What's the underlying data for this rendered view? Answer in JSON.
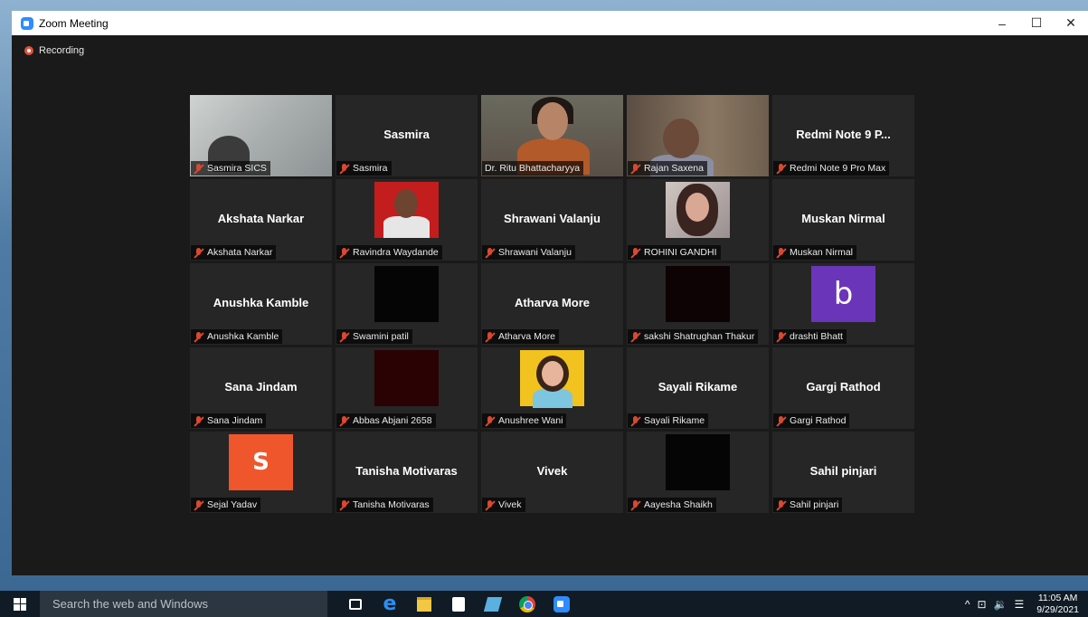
{
  "window": {
    "title": "Zoom Meeting",
    "controls": {
      "minimize": "–",
      "maximize": "☐",
      "close": "✕"
    }
  },
  "recording": {
    "label": "Recording"
  },
  "participants": [
    {
      "tile_name": "",
      "label": "Sasmira SICS"
    },
    {
      "tile_name": "Sasmira",
      "label": "Sasmira"
    },
    {
      "tile_name": "",
      "label": "Dr. Ritu Bhattacharyya"
    },
    {
      "tile_name": "",
      "label": "Rajan Saxena"
    },
    {
      "tile_name": "Redmi Note 9 P...",
      "label": "Redmi Note 9 Pro Max"
    },
    {
      "tile_name": "Akshata Narkar",
      "label": "Akshata Narkar"
    },
    {
      "tile_name": "",
      "label": "Ravindra Waydande"
    },
    {
      "tile_name": "Shrawani Valanju",
      "label": "Shrawani Valanju"
    },
    {
      "tile_name": "",
      "label": "ROHINI GANDHI"
    },
    {
      "tile_name": "Muskan Nirmal",
      "label": "Muskan Nirmal"
    },
    {
      "tile_name": "Anushka Kamble",
      "label": "Anushka Kamble"
    },
    {
      "tile_name": "",
      "label": "Swamini patil"
    },
    {
      "tile_name": "Atharva More",
      "label": "Atharva More"
    },
    {
      "tile_name": "",
      "label": "sakshi Shatrughan Thakur"
    },
    {
      "tile_name": "",
      "label": "drashti Bhatt",
      "avatar_letter": "b"
    },
    {
      "tile_name": "Sana Jindam",
      "label": "Sana Jindam"
    },
    {
      "tile_name": "",
      "label": "Abbas Abjani 2658"
    },
    {
      "tile_name": "",
      "label": "Anushree Wani"
    },
    {
      "tile_name": "Sayali Rikame",
      "label": "Sayali Rikame"
    },
    {
      "tile_name": "Gargi Rathod",
      "label": "Gargi Rathod"
    },
    {
      "tile_name": "",
      "label": "Sejal Yadav",
      "avatar_letter": "S"
    },
    {
      "tile_name": "Tanisha Motivaras",
      "label": "Tanisha Motivaras"
    },
    {
      "tile_name": "Vivek",
      "label": "Vivek"
    },
    {
      "tile_name": "",
      "label": "Aayesha Shaikh"
    },
    {
      "tile_name": "Sahil pinjari",
      "label": "Sahil pinjari"
    }
  ],
  "colors": {
    "active_speaker_border": "#c9e25a",
    "muted_mic": "#d9482f",
    "zoom_blue": "#2d8cff"
  },
  "taskbar": {
    "search_placeholder": "Search the web and Windows",
    "apps": [
      "task-view-icon",
      "edge-icon",
      "file-explorer-icon",
      "store-icon",
      "app-icon",
      "chrome-icon",
      "zoom-icon"
    ],
    "tray": {
      "chevron": "^",
      "network": "⊡",
      "volume": "🔉",
      "notification": "☰"
    },
    "time": "11:05 AM",
    "date": "9/29/2021"
  }
}
